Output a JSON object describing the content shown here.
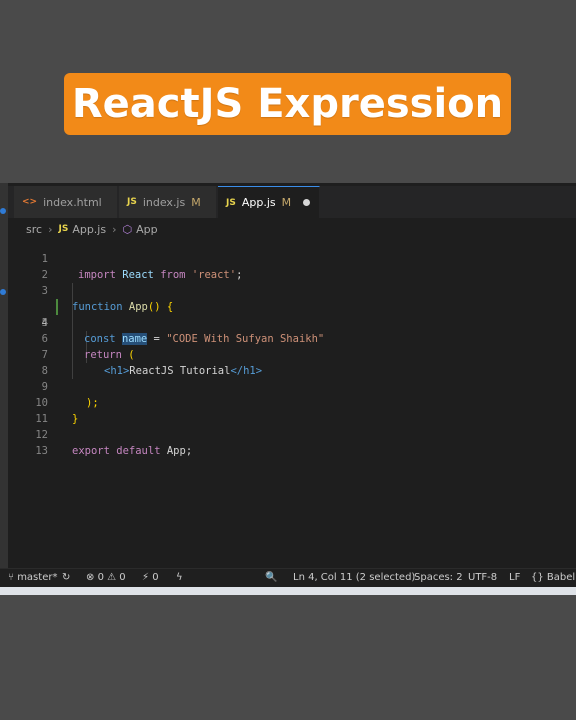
{
  "banner": {
    "title": "ReactJS Expression"
  },
  "tabs": [
    {
      "icon": "html-file-icon",
      "label": "index.html",
      "modified": ""
    },
    {
      "icon": "js-file-icon",
      "label": "index.js",
      "modified": "M"
    },
    {
      "icon": "js-file-icon",
      "label": "App.js",
      "modified": "M",
      "active": true
    }
  ],
  "breadcrumb": {
    "folder": "src",
    "file": "App.js",
    "symbol": "App",
    "file_icon": "JS"
  },
  "code": {
    "current_line": 4,
    "lines": [
      {
        "n": "1",
        "parts": [
          "import",
          " React ",
          "from",
          " ",
          "'react'",
          ";"
        ]
      },
      {
        "n": "2"
      },
      {
        "n": "3",
        "parts": [
          "function",
          " ",
          "App",
          "() {"
        ]
      },
      {
        "n": "4",
        "parts": [
          "const",
          " ",
          "name",
          " = ",
          "\"CODE With Sufyan Shaikh\""
        ]
      },
      {
        "n": "5"
      },
      {
        "n": "6",
        "parts": [
          "return",
          " ("
        ]
      },
      {
        "n": "7",
        "parts": [
          "<h1>",
          "ReactJS Tutorial",
          "</h1>"
        ]
      },
      {
        "n": "8"
      },
      {
        "n": "9",
        "parts": [
          ");"
        ]
      },
      {
        "n": "10",
        "parts": [
          "}"
        ]
      },
      {
        "n": "11"
      },
      {
        "n": "12",
        "parts": [
          "export",
          " ",
          "default",
          " App;"
        ]
      },
      {
        "n": "13"
      }
    ]
  },
  "statusbar": {
    "branch": "master*",
    "errors": "0",
    "warnings": "0",
    "ports": "0",
    "cursor": "Ln 4, Col 11 (2 selected)",
    "spaces": "Spaces: 2",
    "encoding": "UTF-8",
    "eol": "LF",
    "language": "Babel"
  },
  "colors": {
    "banner": "#f28a18",
    "editor_bg": "#1e1e1e",
    "keyword": "#569cd6",
    "string": "#ce9178",
    "selection": "#264f78"
  }
}
